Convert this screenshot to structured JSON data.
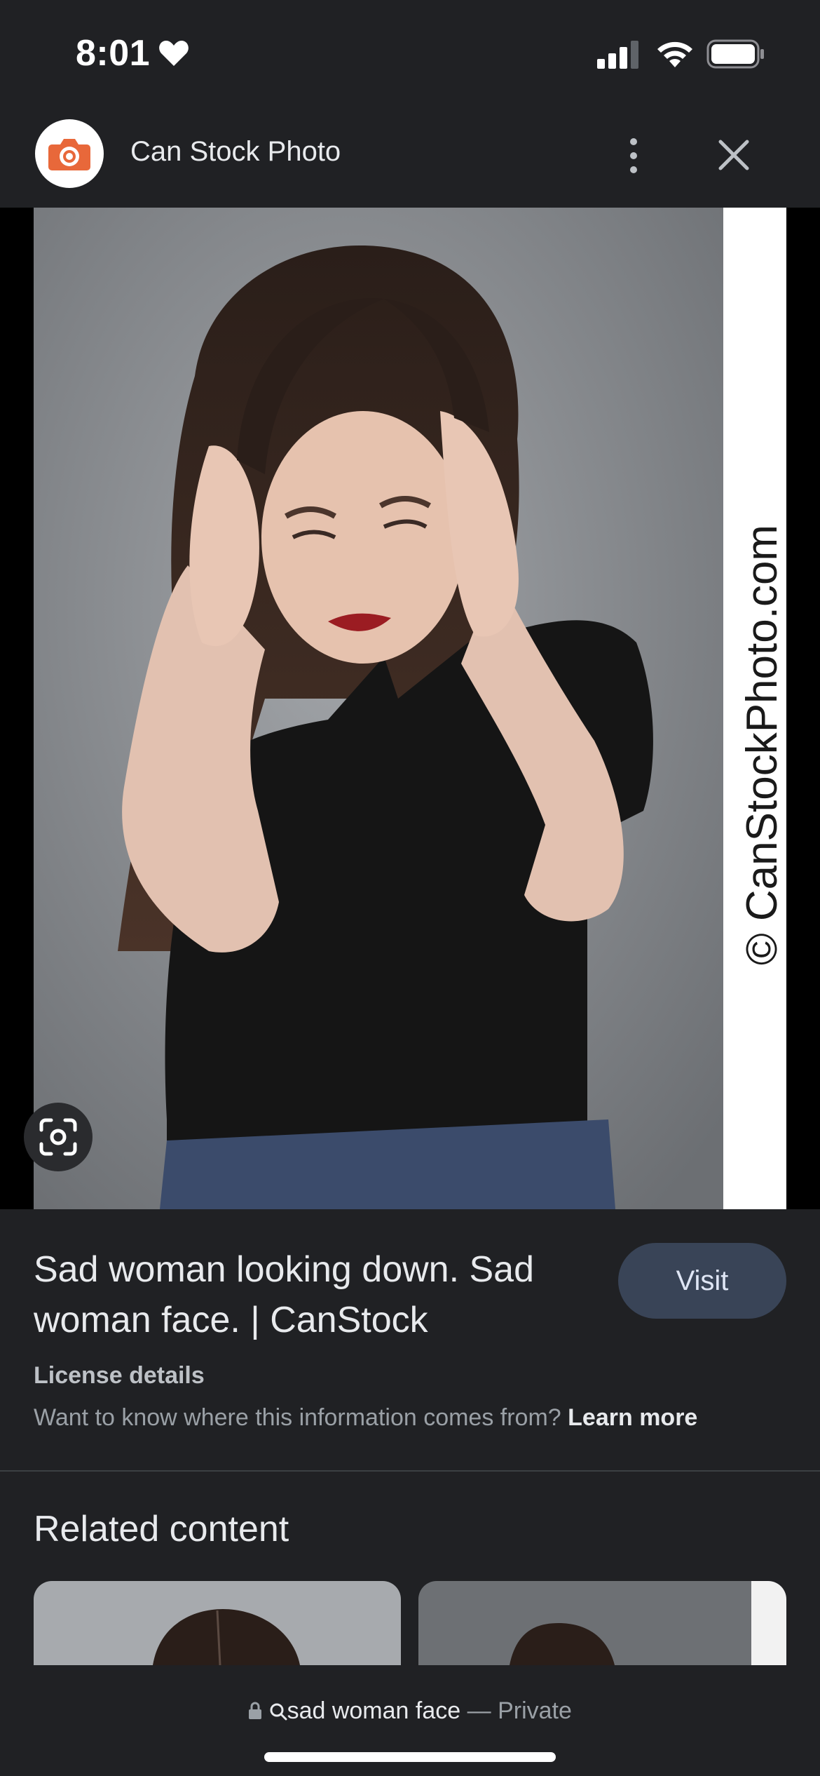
{
  "status_bar": {
    "time": "8:01",
    "icons": [
      "heart-icon",
      "cellular-signal-icon",
      "wifi-icon",
      "battery-icon"
    ]
  },
  "header": {
    "site_name": "Can Stock Photo",
    "logo_icon": "camera-icon",
    "accent": "#e8683a",
    "actions": [
      "more-vertical-icon",
      "close-icon"
    ]
  },
  "image": {
    "watermark": "© CanStockPhoto.com",
    "lens_icon": "google-lens-icon"
  },
  "result": {
    "title": "Sad woman looking down. Sad woman face. | CanStock",
    "visit_label": "Visit",
    "license_label": "License details",
    "license_note": "Want to know where this information comes from?",
    "learn_more": "Learn more"
  },
  "related": {
    "title": "Related content"
  },
  "bottom_bar": {
    "query": "sad woman face",
    "separator": " — ",
    "privacy": "Private"
  }
}
